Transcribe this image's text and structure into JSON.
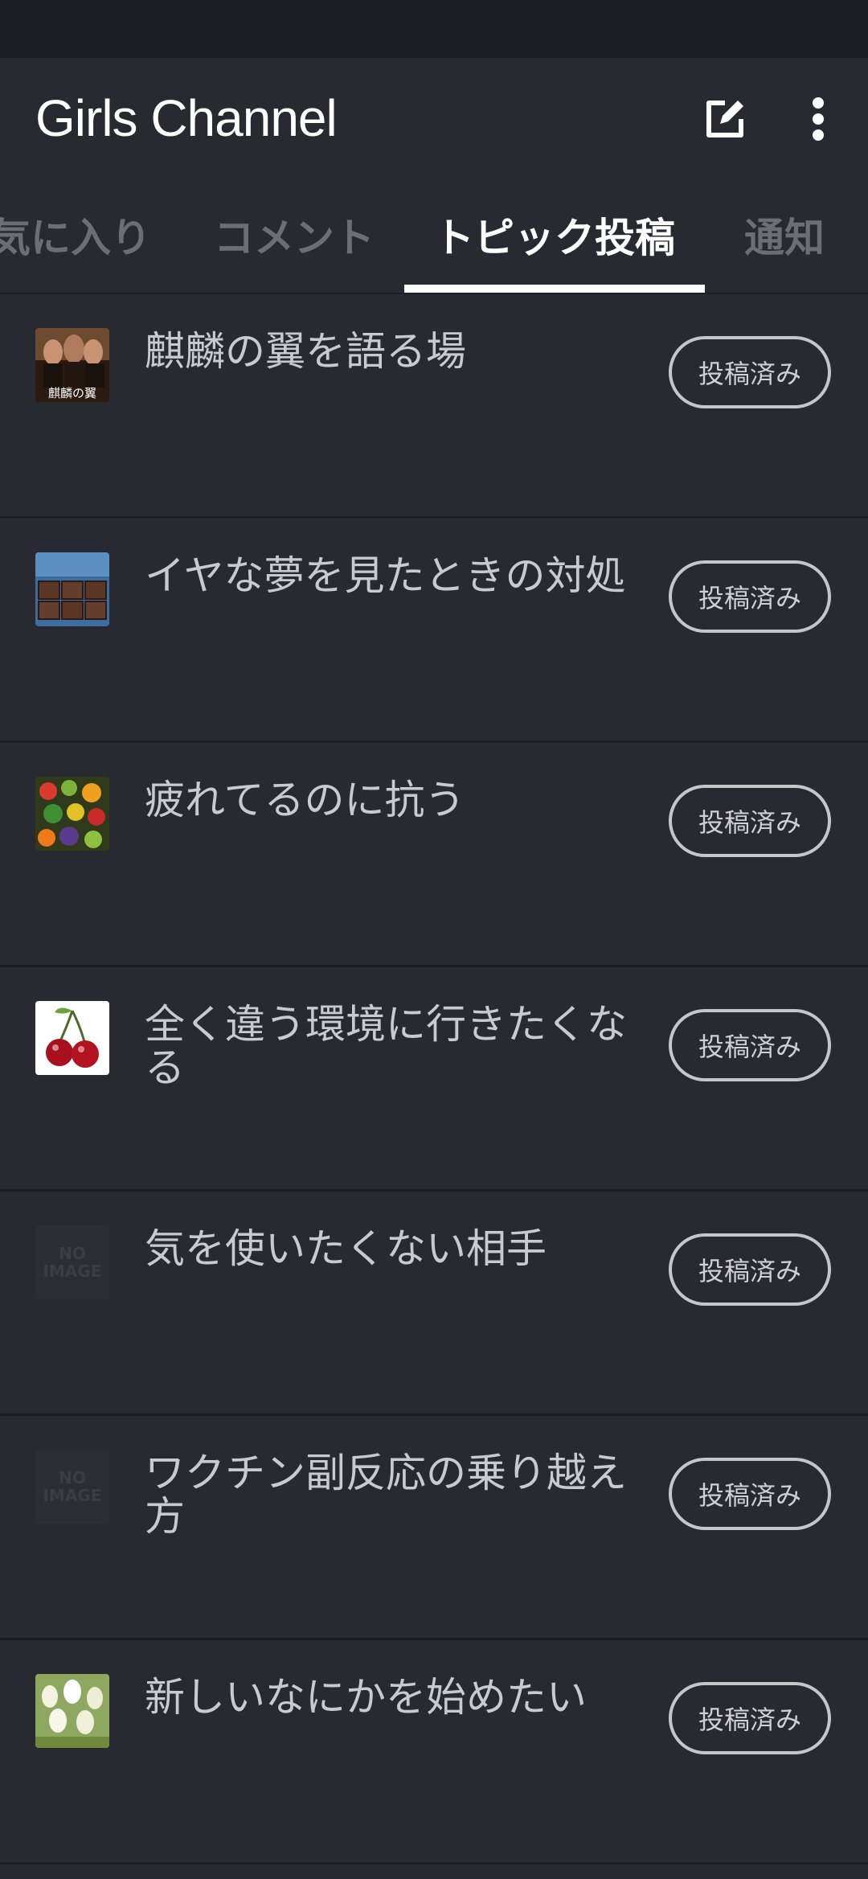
{
  "app": {
    "title": "Girls Channel",
    "compose_icon": "compose-icon",
    "more_icon": "more-vert-icon"
  },
  "tabs": [
    {
      "label": "気に入り"
    },
    {
      "label": "コメント"
    },
    {
      "label": "トピック投稿",
      "active": true
    },
    {
      "label": "通知"
    }
  ],
  "topics": [
    {
      "title": "麒麟の翼を語る場",
      "thumb_caption": "麒麟の翼",
      "status": "投稿済み"
    },
    {
      "title": "イヤな夢を見たときの対処",
      "status": "投稿済み"
    },
    {
      "title": "疲れてるのに抗う",
      "status": "投稿済み"
    },
    {
      "title": "全く違う環境に行きたくなる",
      "status": "投稿済み"
    },
    {
      "title": "気を使いたくない相手",
      "thumb_text": "NO IMAGE",
      "status": "投稿済み"
    },
    {
      "title": "ワクチン副反応の乗り越え方",
      "thumb_text": "NO IMAGE",
      "status": "投稿済み"
    },
    {
      "title": "新しいなにかを始めたい",
      "status": "投稿済み"
    }
  ],
  "colors": {
    "background": "#282931",
    "statusbar": "#1e1f26",
    "divider": "#1c1d23",
    "active_tab": "#ffffff",
    "inactive_tab": "#6d6e75",
    "title_text": "#c9cacf",
    "button_border": "#c6c6ca"
  }
}
